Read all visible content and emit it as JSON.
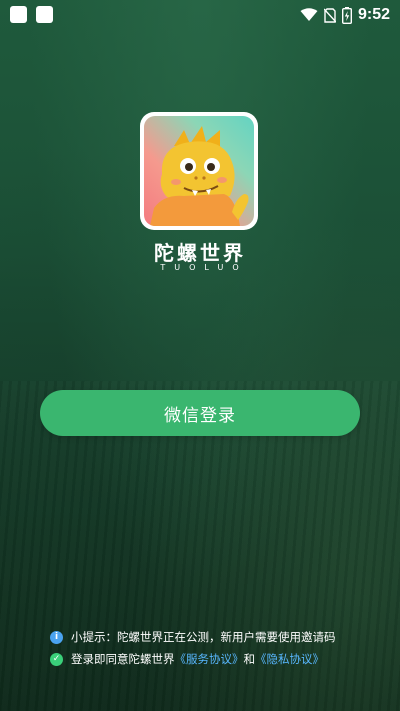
{
  "status_bar": {
    "time": "9:52",
    "icons": [
      "square-icon",
      "square-icon",
      "wifi-icon",
      "no-sim-icon",
      "battery-charging-icon"
    ]
  },
  "brand": {
    "logo_icon": "dinosaur-mascot-icon",
    "title": "陀螺世界",
    "subtitle": "TUOLUO"
  },
  "login": {
    "wechat_label": "微信登录"
  },
  "notes": {
    "hint_text": "小提示：陀螺世界正在公测，新用户需要使用邀请码",
    "agree_prefix": "登录即同意陀螺世界",
    "service_link": "《服务协议》",
    "and_text": "和",
    "privacy_link": "《隐私协议》"
  },
  "colors": {
    "background_dark_green": "#1b4f36",
    "button_green": "#3ab66f",
    "link_blue": "#58b7ff",
    "info_icon_blue": "#4aa3f0",
    "check_icon_green": "#3ad07a"
  }
}
